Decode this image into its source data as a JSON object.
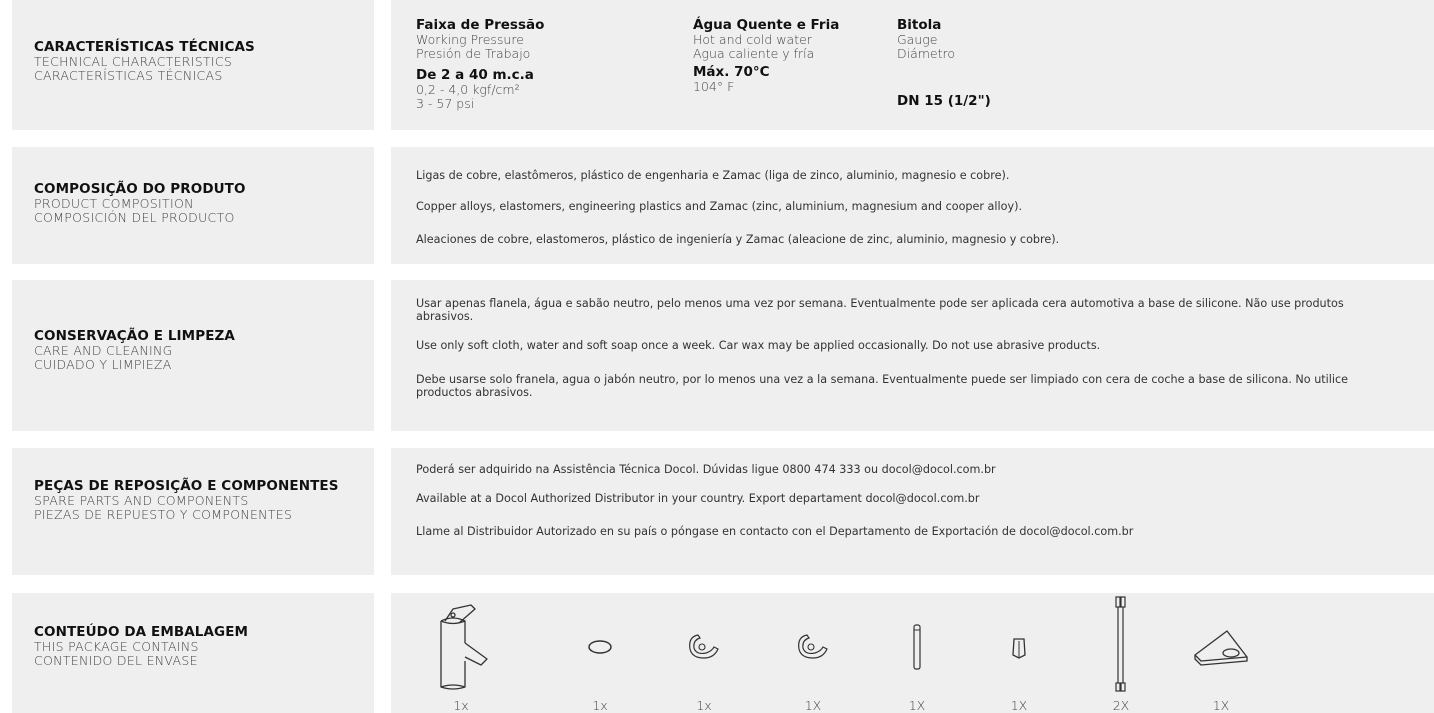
{
  "technical": {
    "title": [
      "CARACTERÍSTICAS TÉCNICAS",
      "TECHNICAL CHARACTERISTICS",
      "CARACTERÍSTICAS TÉCNICAS"
    ],
    "pressure": {
      "heading": "Faixa de Pressão",
      "sub1": "Working Pressure",
      "sub2": "Presión de Trabajo",
      "value": "De 2 a 40 m.c.a",
      "v1": "0,2 - 4,0 kgf/cm²",
      "v2": "3 - 57 psi"
    },
    "water": {
      "heading": "Água Quente e Fria",
      "sub1": "Hot and cold water",
      "sub2": "Agua caliente y fría",
      "value": "Máx. 70°C",
      "v1": "104° F"
    },
    "gauge": {
      "heading": "Bitola",
      "sub1": "Gauge",
      "sub2": "Diámetro",
      "value": "DN 15 (1/2\")"
    }
  },
  "composition": {
    "title": [
      "COMPOSIÇÃO DO  PRODUTO",
      "PRODUCT  COMPOSITION",
      "COMPOSICIÓN  DEL PRODUCTO"
    ],
    "p": [
      "Ligas  de  cobre,  elastômeros,   plástico   de  engenharia   e  Zamac  (liga de zinco, aluminio, magnesio e cobre).",
      "Copper  alloys,  elastomers,  engineering   plastics  and  Zamac  (zinc,  aluminium,  magnesium  and  cooper  alloy).",
      "Aleaciones de cobre, elastomeros, plástico de ingeniería y Zamac (aleacione de zinc, aluminio, magnesio y cobre)."
    ]
  },
  "care": {
    "title": [
      "CONSERVAÇÃO E LIMPEZA",
      "CARE AND CLEANING",
      "CUIDADO Y LIMPIEZA"
    ],
    "p": [
      "Usar apenas flanela, água e sabão neutro, pelo menos uma vez por semana. Eventualmente pode ser aplicada cera automotiva a base de silicone. Não use produtos abrasivos.",
      "Use only soft cloth, water and soft soap once a week. Car wax may be applied occasionally. Do not use abrasive products.",
      "Debe usarse solo franela, agua o jabón neutro, por lo menos una vez a la semana. Eventualmente puede ser limpiado con cera de coche a base de silicona. No utilice productos  abrasivos."
    ]
  },
  "spare": {
    "title": [
      "PEÇAS DE REPOSIÇÃO E COMPONENTES",
      "SPARE PARTS AND COMPONENTS",
      "PIEZAS DE REPUESTO Y  COMPONENTES"
    ],
    "p": [
      "Poderá ser adquirido na Assistência Técnica Docol. Dúvidas ligue 0800 474 333 ou docol@docol.com.br",
      "Available at a Docol Authorized Distributor in your country. Export departament docol@docol.com.br",
      "Llame al Distribuidor Autorizado en su país o póngase en contacto con el Departamento de Exportación de docol@docol.com.br"
    ]
  },
  "package": {
    "title": [
      "CONTEÚDO DA EMBALAGEM",
      "THIS PACKAGE CONTAINS",
      "CONTENIDO DEL ENVASE"
    ],
    "items": [
      {
        "icon": "faucet-icon",
        "qty": "1x"
      },
      {
        "icon": "o-ring-icon",
        "qty": "1x"
      },
      {
        "icon": "clip-icon",
        "qty": "1x"
      },
      {
        "icon": "clip-icon",
        "qty": "1X"
      },
      {
        "icon": "pin-icon",
        "qty": "1X"
      },
      {
        "icon": "nut-icon",
        "qty": "1X"
      },
      {
        "icon": "flexible-hose-icon",
        "qty": "2X"
      },
      {
        "icon": "mounting-bracket-icon",
        "qty": "1X"
      }
    ]
  }
}
